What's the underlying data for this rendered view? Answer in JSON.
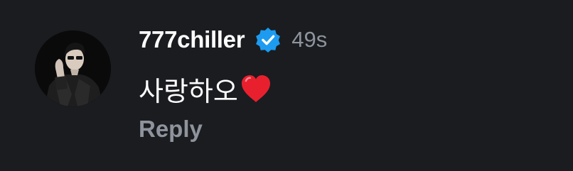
{
  "comment": {
    "username": "777chiller",
    "verified": true,
    "timestamp": "49s",
    "text": "사랑하오",
    "emoji_icon": "red-heart-icon",
    "reply_label": "Reply"
  },
  "colors": {
    "background": "#1a1c20",
    "username": "#ffffff",
    "muted": "#8e939c",
    "verified_badge": "#1d9bf0",
    "heart": "#e8202e"
  }
}
